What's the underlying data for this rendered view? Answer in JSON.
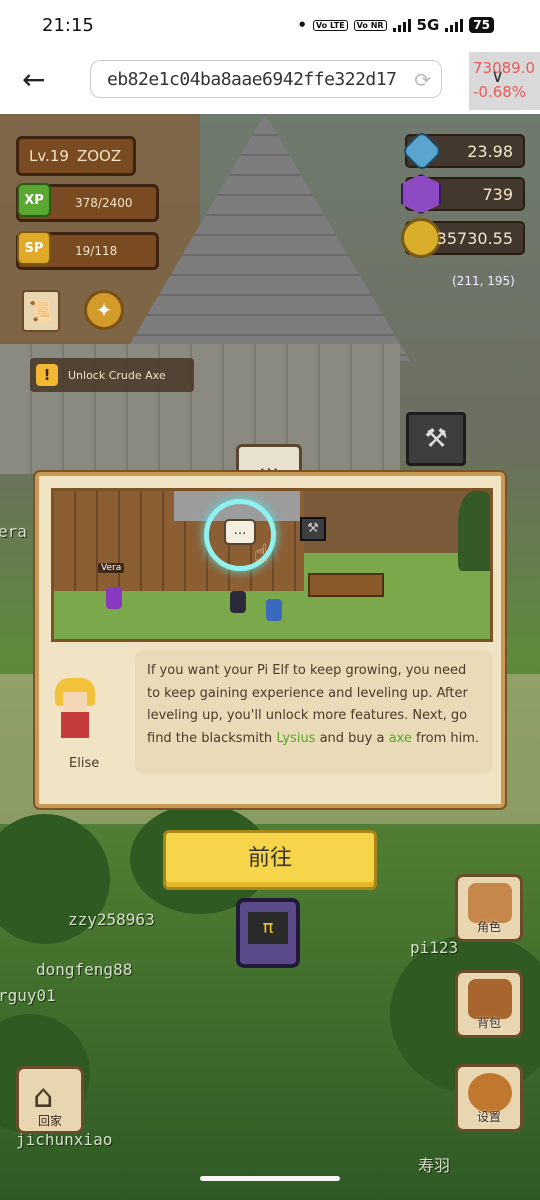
{
  "status_bar": {
    "time": "21:15",
    "net_badge_1": "Vo LTE",
    "net_badge_2": "Vo NR",
    "network": "5G",
    "battery": "75"
  },
  "browser": {
    "url": "eb82e1c04ba8aae6942ffe322d17",
    "price_value": "73089.0",
    "price_change": "-0.68%"
  },
  "hud": {
    "level": "Lv.19",
    "player_name": "ZOOZ",
    "xp_label": "XP",
    "xp_value": "378/2400",
    "sp_label": "SP",
    "sp_value": "19/118",
    "unlock_hint": "Unlock Crude Axe",
    "resources": {
      "leaf": "23.98",
      "gem": "739",
      "coin": "35730.55"
    },
    "coordinates": "(211, 195)"
  },
  "dialog": {
    "scene_npc_label": "Vera",
    "speaker_name": "Elise",
    "message_part1": "If you want your Pi Elf to keep growing, you need to keep gaining experience and leveling up. After leveling up, you'll unlock more features. Next, go find the blacksmith ",
    "highlight_1": "Lysius",
    "message_part2": " and buy a ",
    "highlight_2": "axe",
    "message_part3": " from him.",
    "go_button": "前往"
  },
  "map_players": {
    "p1": "zzy258963",
    "p2": "dongfeng88",
    "p3": "rguy01",
    "p4": "pi123",
    "p5": "jichunxiao",
    "p6": "era",
    "p7": "寿羽"
  },
  "menu": {
    "character": "角色",
    "bag": "背包",
    "settings": "设置",
    "home": "回家"
  },
  "colors": {
    "accent_button": "#f6d54a",
    "highlight_text": "#5aa62a",
    "price_red": "#e85a5a"
  }
}
